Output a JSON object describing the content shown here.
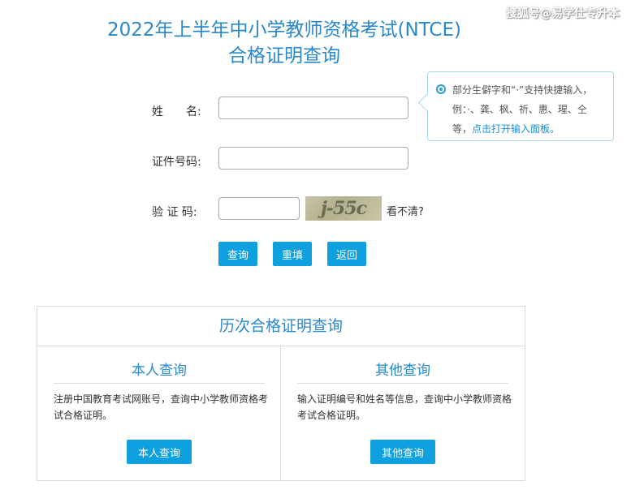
{
  "header": {
    "title_line1": "2022年上半年中小学教师资格考试(NTCE)",
    "title_line2": "合格证明查询",
    "watermark": "搜狐号@易学仕专升本"
  },
  "form": {
    "name_label": "姓　　名:",
    "id_label": "证件号码:",
    "captcha_label": "验 证 码:",
    "captcha_text": "j-55c",
    "unclear_link": "看不清?",
    "query_button": "查询",
    "reset_button": "重填",
    "back_button": "返回"
  },
  "tooltip": {
    "text": "部分生僻字和“·”支持快捷输入，例：·、龚、枫、祈、惠、瑆、仝等，",
    "link": "点击打开输入面板。"
  },
  "history": {
    "title": "历次合格证明查询",
    "self": {
      "heading": "本人查询",
      "desc": "注册中国教育考试网账号，查询中小学教师资格考试合格证明。",
      "button": "本人查询"
    },
    "other": {
      "heading": "其他查询",
      "desc": "输入证明编号和姓名等信息，查询中小学教师资格考试合格证明。",
      "button": "其他查询"
    }
  },
  "colors": {
    "accent": "#2a88c9",
    "button": "#0fa0e0"
  }
}
